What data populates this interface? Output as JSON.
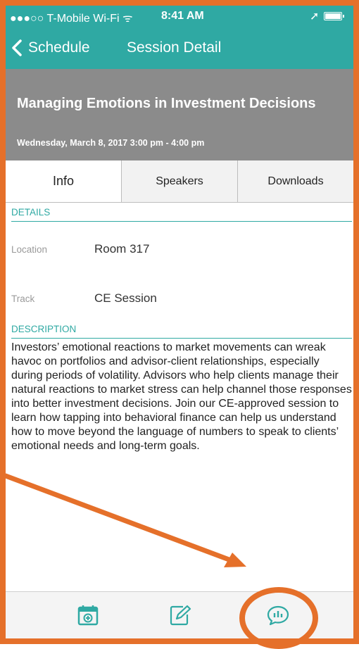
{
  "status_bar": {
    "carrier": "●●●○○ T-Mobile Wi-Fi ᯤ",
    "time": "8:41 AM"
  },
  "nav": {
    "back_label": "Schedule",
    "title": "Session Detail"
  },
  "session": {
    "title": "Managing Emotions in Investment Decisions",
    "datetime": "Wednesday, March 8, 2017 3:00 pm - 4:00 pm"
  },
  "tabs": [
    {
      "label": "Info",
      "active": true
    },
    {
      "label": "Speakers",
      "active": false
    },
    {
      "label": "Downloads",
      "active": false
    }
  ],
  "details": {
    "heading": "DETAILS",
    "location_label": "Location",
    "location_value": "Room 317",
    "track_label": "Track",
    "track_value": "CE Session"
  },
  "description": {
    "heading": "DESCRIPTION",
    "text": "Investors’ emotional reactions to market movements can wreak havoc on portfolios and advisor-client relationships, especially during periods of volatility. Advisors who help clients manage their natural reactions to market stress can help channel those responses into better investment decisions. Join our CE-approved session to learn how tapping into behavioral finance can help us understand how to move beyond the language of numbers to speak to clients’ emotional needs and long-term goals."
  },
  "toolbar": {
    "icons": [
      "calendar-add-icon",
      "note-edit-icon",
      "poll-chat-icon"
    ]
  },
  "colors": {
    "accent": "#2fa9a3",
    "header_bg": "#8b8b8b",
    "annotation": "#e5702a"
  }
}
